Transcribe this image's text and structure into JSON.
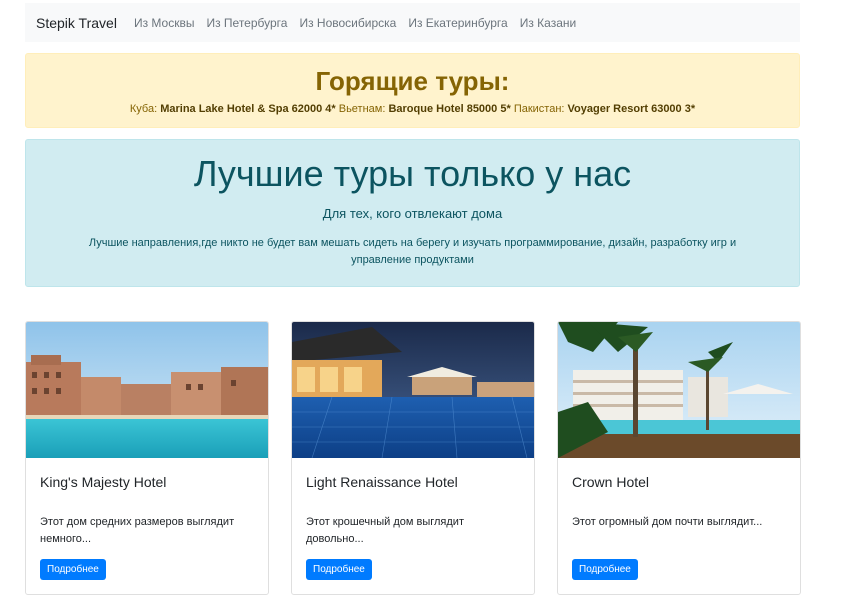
{
  "navbar": {
    "brand": "Stepik Travel",
    "links": [
      "Из Москвы",
      "Из Петербурга",
      "Из Новосибирска",
      "Из Екатеринбурга",
      "Из Казани"
    ]
  },
  "hot": {
    "title": "Горящие туры:",
    "items": [
      {
        "country": "Куба:",
        "hotel": "Marina Lake Hotel & Spa 62000 4*"
      },
      {
        "country": "Вьетнам:",
        "hotel": "Baroque Hotel 85000 5*"
      },
      {
        "country": "Пакистан:",
        "hotel": "Voyager Resort 63000 3*"
      }
    ]
  },
  "jumbo": {
    "title": "Лучшие туры только у нас",
    "subtitle": "Для тех, кого отвлекают дома",
    "text": "Лучшие направления,где никто не будет вам мешать сидеть на берегу и изучать программирование, дизайн, разработку игр и управление продуктами"
  },
  "cards": [
    {
      "title": "King's Majesty Hotel",
      "text": "Этот дом средних размеров выглядит немного...",
      "button": "Подробнее"
    },
    {
      "title": "Light Renaissance Hotel",
      "text": "Этот крошечный дом выглядит довольно...",
      "button": "Подробнее"
    },
    {
      "title": "Crown Hotel",
      "text": "Этот огромный дом почти выглядит...",
      "button": "Подробнее"
    }
  ],
  "colors": {
    "primary": "#007bff",
    "warning_bg": "#fff3cd",
    "info_bg": "#d1ecf1"
  }
}
